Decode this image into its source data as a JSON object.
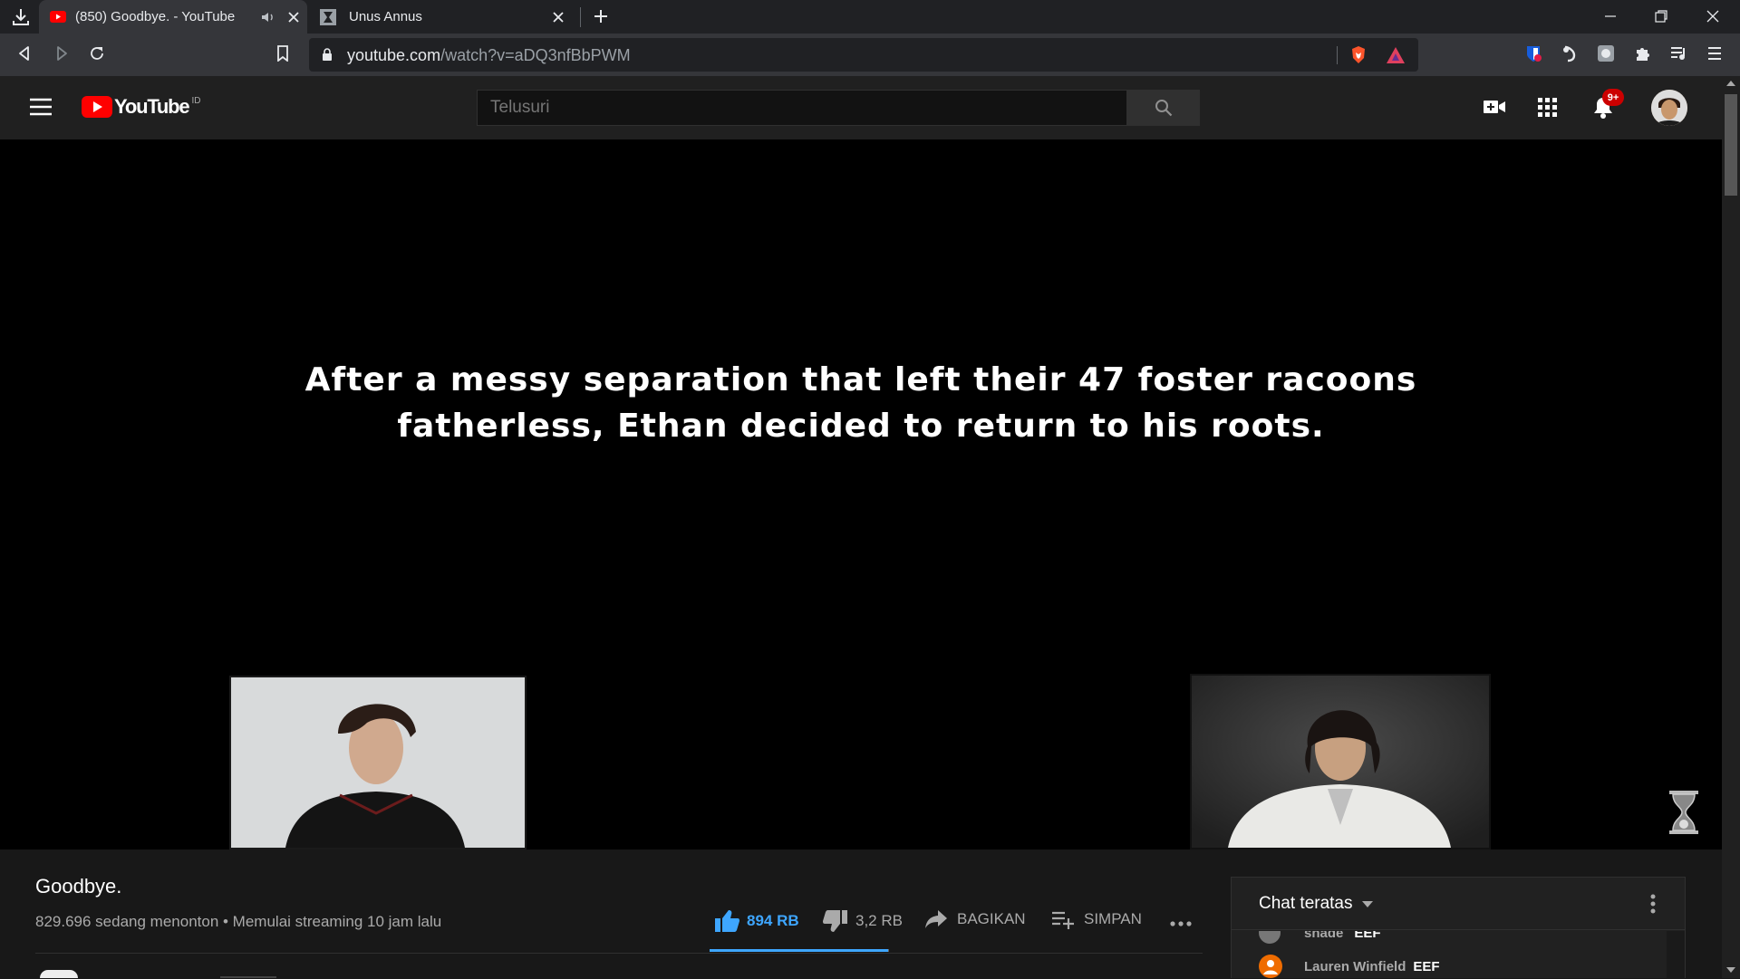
{
  "browser": {
    "tabs": [
      {
        "title": "(850) Goodbye. - YouTube",
        "active": true,
        "icon": "youtube-favicon",
        "audio": true
      },
      {
        "title": "Unus Annus",
        "active": false,
        "icon": "unus-annus-favicon"
      }
    ],
    "url": {
      "host": "youtube.com",
      "path": "/watch?v=aDQ3nfBbPWM"
    },
    "colors": {
      "tabbar": "#202124",
      "toolbar": "#35363a"
    }
  },
  "youtube": {
    "logo_text": "YouTube",
    "region": "ID",
    "search_placeholder": "Telusuri",
    "notifications_badge": "9+",
    "colors": {
      "brand_red": "#ff0000",
      "header": "#202020",
      "accent_blue": "#3ea6ff"
    }
  },
  "video": {
    "caption_line1": "After a messy separation that left their 47 foster racoons",
    "caption_line2": "fatherless, Ethan decided to return to his roots.",
    "title": "Goodbye.",
    "stats": "829.696 sedang menonton • Memulai streaming 10 jam lalu",
    "like_count": "894 RB",
    "dislike_count": "3,2 RB",
    "share_label": "BAGIKAN",
    "save_label": "SIMPAN",
    "like_ratio": 0.996
  },
  "chat": {
    "header": "Chat teratas",
    "messages": [
      {
        "author": "shade",
        "text": "EEF"
      },
      {
        "author": "Lauren Winfield",
        "text": "EEF"
      }
    ]
  }
}
